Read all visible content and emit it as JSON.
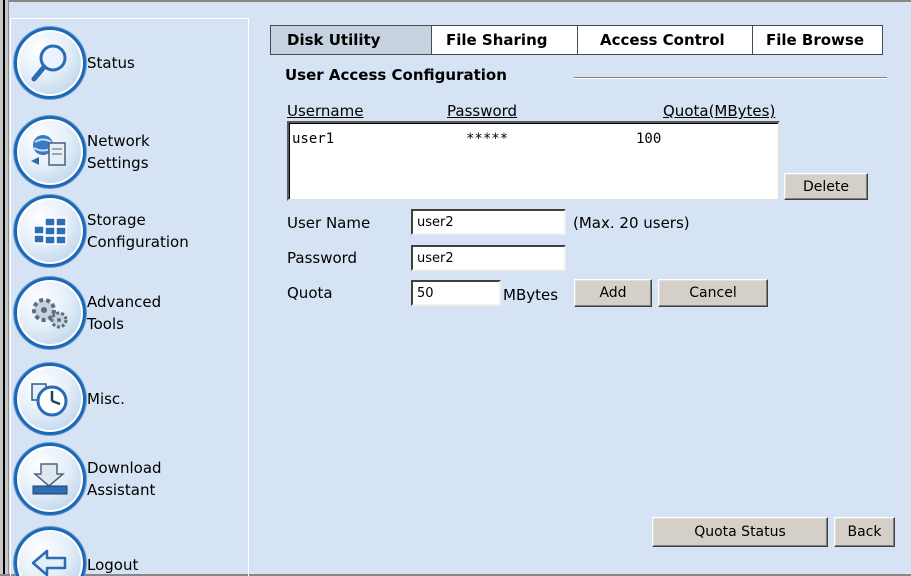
{
  "sidebar": {
    "items": [
      {
        "label": "Status",
        "icon": "magnifier-icon"
      },
      {
        "label": "Network\nSettings",
        "icon": "network-server-icon"
      },
      {
        "label": "Storage\nConfiguration",
        "icon": "storage-grid-icon"
      },
      {
        "label": "Advanced\nTools",
        "icon": "gears-icon"
      },
      {
        "label": "Misc.",
        "icon": "clock-icon"
      },
      {
        "label": "Download\nAssistant",
        "icon": "download-tray-icon"
      },
      {
        "label": "Logout",
        "icon": "back-arrow-icon"
      }
    ]
  },
  "tabs": [
    {
      "label": "Disk Utility",
      "active": true
    },
    {
      "label": "File Sharing",
      "active": false
    },
    {
      "label": "Access Control",
      "active": false
    },
    {
      "label": "File Browse",
      "active": false
    }
  ],
  "section": {
    "title": "User Access Configuration"
  },
  "userlist": {
    "headers": {
      "username": "Username",
      "password": "Password",
      "quota": "Quota(MBytes)"
    },
    "rows": [
      {
        "username": "user1",
        "password": "*****",
        "quota": "100"
      }
    ]
  },
  "buttons": {
    "delete": "Delete",
    "add": "Add",
    "cancel": "Cancel",
    "quota_status": "Quota Status",
    "back": "Back"
  },
  "form": {
    "username_label": "User Name",
    "username_value": "user2",
    "username_hint": "(Max. 20 users)",
    "password_label": "Password",
    "password_value": "user2",
    "quota_label": "Quota",
    "quota_value": "50",
    "quota_unit": "MBytes"
  },
  "colors": {
    "background": "#d5e3f4",
    "icon_ring": "#1c68b8",
    "active_tab": "#c6d2df"
  }
}
